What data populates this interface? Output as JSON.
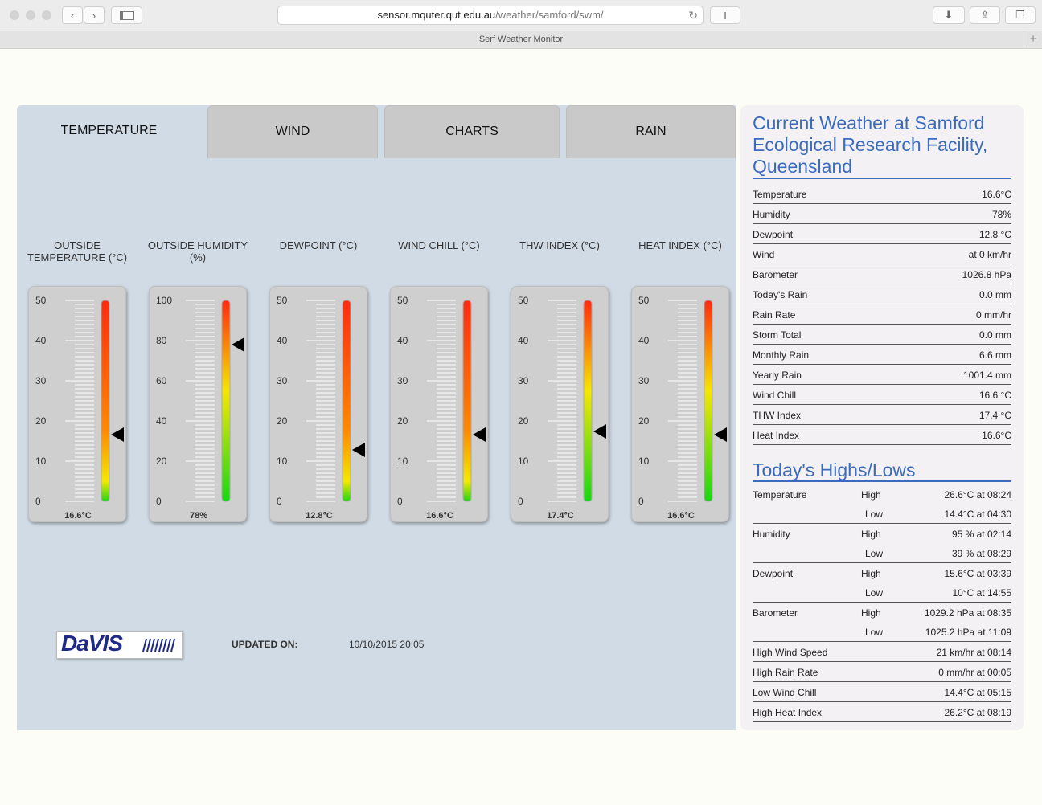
{
  "browser": {
    "url_host": "sensor.mquter.qut.edu.au",
    "url_path": "/weather/samford/swm/",
    "tab_title": "Serf Weather Monitor"
  },
  "tabs": [
    "TEMPERATURE",
    "WIND",
    "CHARTS",
    "RAIN"
  ],
  "gauges": [
    {
      "label": "OUTSIDE TEMPERATURE (°C)",
      "scale": [
        0,
        10,
        20,
        30,
        40,
        50
      ],
      "max": 50,
      "value": 16.6,
      "readout": "16.6°C",
      "grad": "temp"
    },
    {
      "label": "OUTSIDE HUMIDITY (%)",
      "scale": [
        0,
        20,
        40,
        60,
        80,
        100
      ],
      "max": 100,
      "value": 78,
      "readout": "78%",
      "grad": "hum"
    },
    {
      "label": "DEWPOINT (°C)",
      "scale": [
        0,
        10,
        20,
        30,
        40,
        50
      ],
      "max": 50,
      "value": 12.8,
      "readout": "12.8°C",
      "grad": "temp"
    },
    {
      "label": "WIND CHILL (°C)",
      "scale": [
        0,
        10,
        20,
        30,
        40,
        50
      ],
      "max": 50,
      "value": 16.6,
      "readout": "16.6°C",
      "grad": "temp"
    },
    {
      "label": "THW INDEX (°C)",
      "scale": [
        0,
        10,
        20,
        30,
        40,
        50
      ],
      "max": 50,
      "value": 17.4,
      "readout": "17.4°C",
      "grad": "hum"
    },
    {
      "label": "HEAT INDEX (°C)",
      "scale": [
        0,
        10,
        20,
        30,
        40,
        50
      ],
      "max": 50,
      "value": 16.6,
      "readout": "16.6°C",
      "grad": "hum"
    }
  ],
  "logo_text": "DaVIS",
  "updated_label": "UPDATED ON:",
  "updated_value": "10/10/2015  20:05",
  "current": {
    "title": "Current Weather at Samford Ecological Research Facility, Queensland",
    "rows": [
      {
        "k": "Temperature",
        "v": "16.6°C"
      },
      {
        "k": "Humidity",
        "v": "78%"
      },
      {
        "k": "Dewpoint",
        "v": "12.8 °C"
      },
      {
        "k": "Wind",
        "v": "at 0 km/hr"
      },
      {
        "k": "Barometer",
        "v": "1026.8 hPa"
      },
      {
        "k": "Today's Rain",
        "v": "0.0 mm"
      },
      {
        "k": "Rain Rate",
        "v": "0 mm/hr"
      },
      {
        "k": "Storm Total",
        "v": "0.0 mm"
      },
      {
        "k": "Monthly Rain",
        "v": "6.6 mm"
      },
      {
        "k": "Yearly Rain",
        "v": "1001.4 mm"
      },
      {
        "k": "Wind Chill",
        "v": "16.6 °C"
      },
      {
        "k": "THW Index",
        "v": "17.4 °C"
      },
      {
        "k": "Heat Index",
        "v": "16.6°C"
      }
    ]
  },
  "highs": {
    "title": "Today's Highs/Lows",
    "pairs": [
      {
        "k": "Temperature",
        "high": "High",
        "hv": "26.6°C at 08:24",
        "low": "Low",
        "lv": "14.4°C at 04:30"
      },
      {
        "k": "Humidity",
        "high": "High",
        "hv": "95 % at 02:14",
        "low": "Low",
        "lv": "39 % at 08:29"
      },
      {
        "k": "Dewpoint",
        "high": "High",
        "hv": "15.6°C at 03:39",
        "low": "Low",
        "lv": "10°C at 14:55"
      },
      {
        "k": "Barometer",
        "high": "High",
        "hv": "1029.2 hPa at 08:35",
        "low": "Low",
        "lv": "1025.2 hPa at 11:09"
      }
    ],
    "singles": [
      {
        "k": "High Wind Speed",
        "v": "21 km/hr at 08:14"
      },
      {
        "k": "High Rain Rate",
        "v": "0 mm/hr at 00:05"
      },
      {
        "k": "Low Wind Chill",
        "v": "14.4°C at 05:15"
      },
      {
        "k": "High Heat Index",
        "v": "26.2°C at 08:19"
      }
    ]
  }
}
